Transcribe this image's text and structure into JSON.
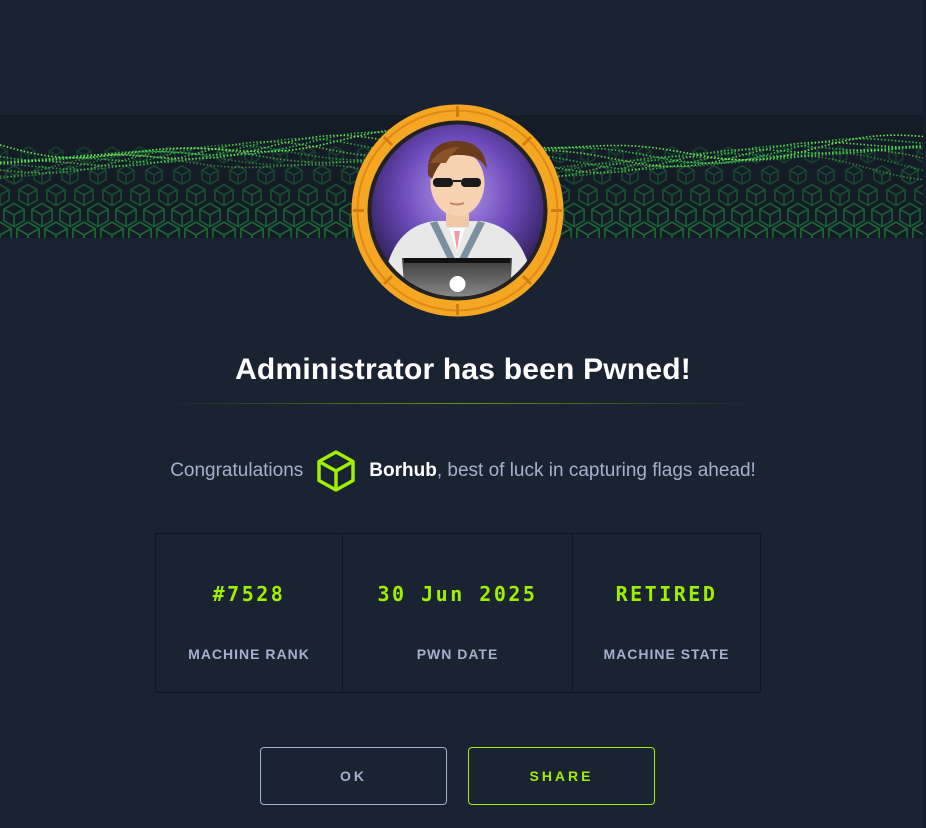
{
  "dialog": {
    "title": "Administrator has been Pwned!",
    "congrats_prefix": "Congratulations",
    "username": "Borhub",
    "congrats_suffix": ", best of luck in capturing flags ahead!"
  },
  "stats": [
    {
      "value": "#7528",
      "label": "MACHINE RANK"
    },
    {
      "value": "30 Jun 2025",
      "label": "PWN DATE"
    },
    {
      "value": "RETIRED",
      "label": "MACHINE STATE"
    }
  ],
  "buttons": {
    "ok_label": "OK",
    "share_label": "SHARE"
  },
  "icons": {
    "banner": "green-cube-wave-banner",
    "avatar": "machine-avatar-icon",
    "user": "green-cube-icon"
  },
  "colors": {
    "background": "#1a2332",
    "accent": "#9fef00",
    "avatar_ring": "#f5a623",
    "muted_text": "#a4b1cd"
  }
}
